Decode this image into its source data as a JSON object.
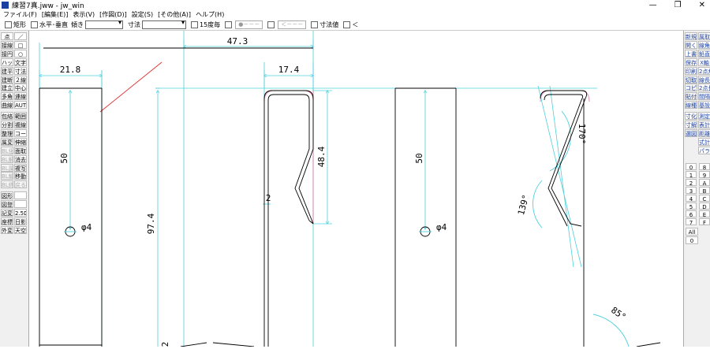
{
  "window": {
    "title": "練習7真.jww - jw_win",
    "controls": [
      "—",
      "❐",
      "✕"
    ]
  },
  "menu": [
    "ファイル(F)",
    "[編集(E)]",
    "表示(V)",
    "[作図(D)]",
    "設定(S)",
    "[その他(A)]",
    "ヘルプ(H)"
  ],
  "toolbar": {
    "rect": "矩形",
    "horiz_vert": "水平･垂直",
    "tilt": "傾き",
    "dim_label": "寸法",
    "deg15": "15度毎",
    "btn_circle": "●－－－",
    "btn_arrow": "＜－－－",
    "dim_value": "寸法値",
    "last": "＜"
  },
  "left_tools": [
    [
      "点",
      "／"
    ],
    [
      "接線",
      "□"
    ],
    [
      "接円",
      "○"
    ],
    [
      "ハッチ",
      "文字"
    ],
    [
      "建平",
      "寸法"
    ],
    [
      "建断",
      "２線"
    ],
    [
      "建立",
      "中心線"
    ],
    [
      "多角形",
      "連線"
    ],
    [
      "曲線",
      "AUTO"
    ],
    [
      "包絡",
      "範囲"
    ],
    [
      "分割",
      "複線"
    ],
    [
      "整理",
      "コーナー"
    ],
    [
      "属変",
      "伸縮"
    ],
    [
      "BL化",
      "面取"
    ],
    [
      "BL解",
      "消去"
    ],
    [
      "BL属",
      "複写"
    ],
    [
      "BL編",
      "移動"
    ],
    [
      "BL終",
      "戻る"
    ],
    [
      "図形",
      ""
    ],
    [
      "図登",
      ""
    ],
    [
      "記変",
      "2.5D"
    ],
    [
      "座標",
      "日影"
    ],
    [
      "外変",
      "天空"
    ]
  ],
  "right_tools": [
    [
      "新規",
      "属取"
    ],
    [
      "開く",
      "線角"
    ],
    [
      "上書",
      "鉛直"
    ],
    [
      "保存",
      "X軸"
    ],
    [
      "印刷",
      "2点角"
    ],
    [
      "切取",
      "線長"
    ],
    [
      "コピー",
      "2点長"
    ],
    [
      "貼付",
      "間隔"
    ],
    [
      "線種",
      "基設"
    ],
    [
      "寸化",
      "測定"
    ],
    [
      "寸解",
      "表計"
    ],
    [
      "選図",
      "距離"
    ],
    [
      "",
      "式計"
    ],
    [
      "",
      "パラメ"
    ]
  ],
  "layers": [
    "0",
    "1",
    "2",
    "3",
    "4",
    "5",
    "6",
    "7",
    "8",
    "9",
    "A",
    "B",
    "C",
    "D",
    "E",
    "F"
  ],
  "layer_all": "All",
  "layer_zero": "0",
  "drawing": {
    "dims": [
      "47.3",
      "21.8",
      "17.4",
      "50",
      "48.4",
      "97.4",
      "50",
      "2",
      "2"
    ],
    "phi": [
      "φ4",
      "φ4"
    ],
    "angles": [
      "139°",
      "170°",
      "85°"
    ]
  },
  "colors": {
    "dim_line": "#4fd0dc",
    "geometry": "#000000",
    "aux_red": "#e03030",
    "aux_pink": "#e070a0"
  }
}
